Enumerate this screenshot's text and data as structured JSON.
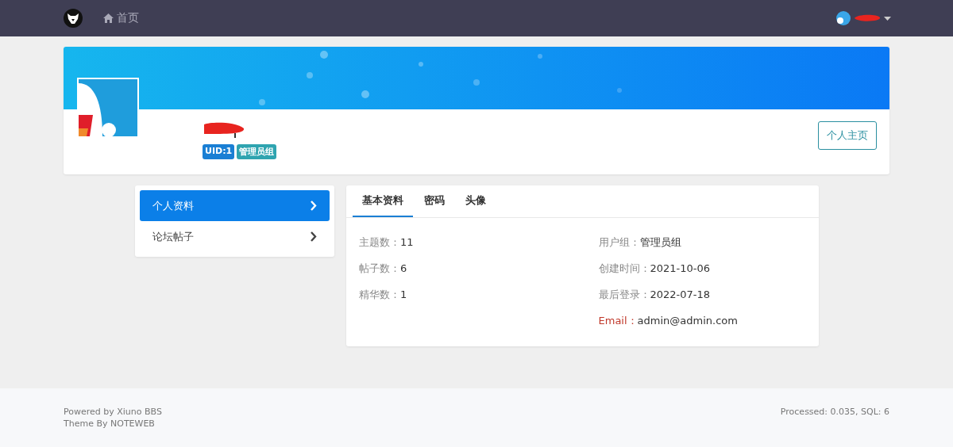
{
  "navbar": {
    "nav_items": [
      {
        "label": "首页",
        "selected": false
      }
    ]
  },
  "profile": {
    "badges": [
      {
        "label": "UID:1",
        "color": "#1a7fd4"
      },
      {
        "label": "管理员组",
        "color": "#2fa4b0"
      }
    ],
    "home_button": "个人主页"
  },
  "side_menu": [
    {
      "label": "个人资料",
      "selected": true
    },
    {
      "label": "论坛帖子",
      "selected": false
    }
  ],
  "tabs": [
    {
      "label": "基本资料",
      "selected": true
    },
    {
      "label": "密码",
      "selected": false
    },
    {
      "label": "头像",
      "selected": false
    }
  ],
  "info_left": [
    {
      "label": "主题数：",
      "value": "11"
    },
    {
      "label": "帖子数：",
      "value": "6"
    },
    {
      "label": "精华数：",
      "value": "1"
    }
  ],
  "info_right": [
    {
      "label": "用户组：",
      "value": "管理员组",
      "kind": "plain"
    },
    {
      "label": "创建时间：",
      "value": "2021-10-06",
      "kind": "plain"
    },
    {
      "label": "最后登录：",
      "value": "2022-07-18",
      "kind": "plain"
    },
    {
      "label": "Email：",
      "value": "admin@admin.com",
      "kind": "accent"
    }
  ],
  "footer": {
    "lines": [
      "Powered by Xiuno BBS",
      "Theme By NOTEWEB"
    ],
    "stats": "Processed: 0.035, SQL: 6"
  }
}
